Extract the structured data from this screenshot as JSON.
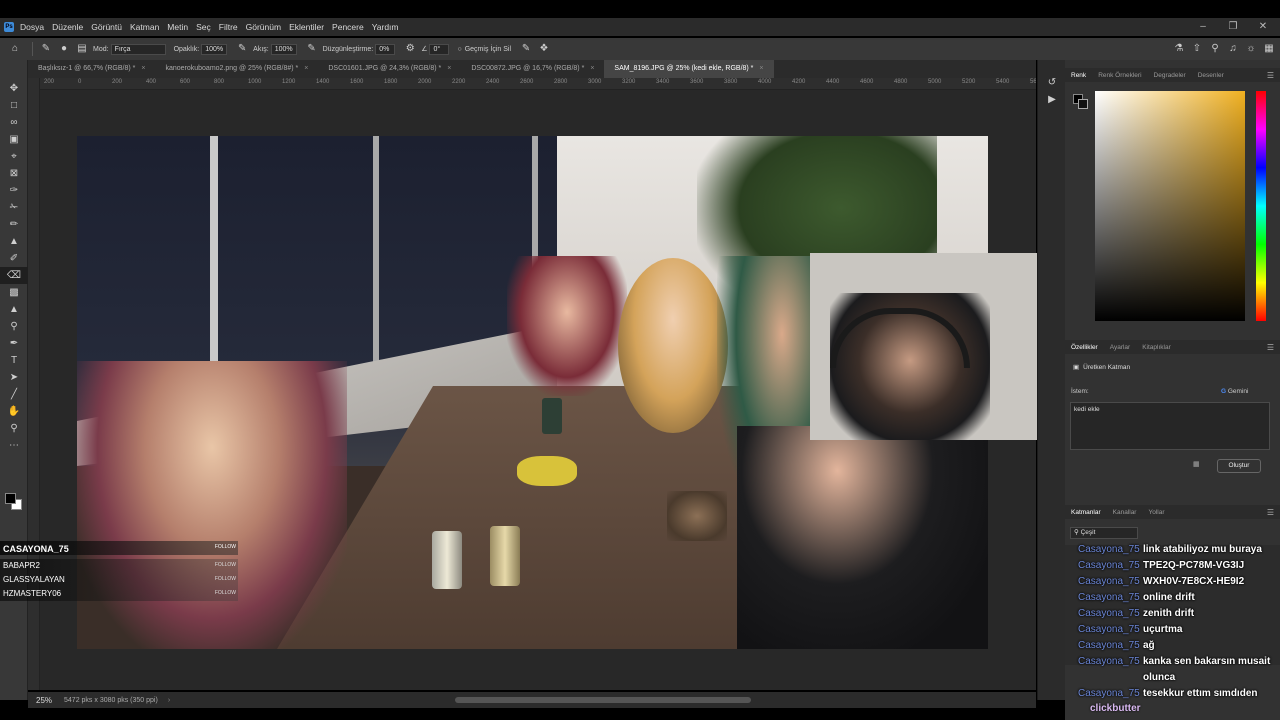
{
  "menu": {
    "items": [
      "Dosya",
      "Düzenle",
      "Görüntü",
      "Katman",
      "Metin",
      "Seç",
      "Filtre",
      "Görünüm",
      "Eklentiler",
      "Pencere",
      "Yardım"
    ]
  },
  "options": {
    "mode_label": "Mod:",
    "mode_value": "Fırça",
    "opacity_label": "Opaklık:",
    "opacity_value": "100%",
    "flow_label": "Akış:",
    "flow_value": "100%",
    "smoothing_label": "Düzgünleştirme:",
    "smoothing_value": "0%",
    "angle_value": "0°",
    "erase_history_label": "Geçmiş İçin Sil"
  },
  "tabs": [
    {
      "label": "Başlıksız-1 @ 66,7% (RGB/8) *",
      "active": false
    },
    {
      "label": "kanoerokuboamo2.png @ 25% (RGB/8#) *",
      "active": false
    },
    {
      "label": "DSC01601.JPG @ 24,3% (RGB/8) *",
      "active": false
    },
    {
      "label": "DSC00872.JPG @ 16,7% (RGB/8) *",
      "active": false
    },
    {
      "label": "SAM_8196.JPG @ 25% (kedi ekle, RGB/8) *",
      "active": true
    }
  ],
  "ruler": [
    "200",
    "0",
    "200",
    "400",
    "600",
    "800",
    "1000",
    "1200",
    "1400",
    "1600",
    "1800",
    "2000",
    "2200",
    "2400",
    "2600",
    "2800",
    "3000",
    "3200",
    "3400",
    "3600",
    "3800",
    "4000",
    "4200",
    "4400",
    "4600",
    "4800",
    "5000",
    "5200",
    "5400",
    "5600"
  ],
  "status": {
    "zoom": "25%",
    "doc_info": "5472 pks x 3080 pks (350 ppi)"
  },
  "color_panel": {
    "tabs": [
      "Renk",
      "Renk Örnekleri",
      "Degradeler",
      "Desenler"
    ]
  },
  "properties_panel": {
    "tabs": [
      "Özellikler",
      "Ayarlar",
      "Kitaplıklar"
    ],
    "layer_type": "Üretken Katman",
    "prompt_label": "İstem:",
    "model_label": "Gemini",
    "prompt_text": "kedi ekle",
    "generate_button": "Oluştur"
  },
  "layers_panel": {
    "tabs": [
      "Katmanlar",
      "Kanallar",
      "Yollar"
    ],
    "filter_label": "Çeşit"
  },
  "follow_panel": {
    "header_name": "CASAYONA_75",
    "header_tag": "FOLLOW",
    "rows": [
      {
        "name": "BABAPR2",
        "tag": "FOLLOW"
      },
      {
        "name": "GLASSYALAYAN",
        "tag": "FOLLOW"
      },
      {
        "name": "HZMASTERY06",
        "tag": "FOLLOW"
      }
    ]
  },
  "chat": [
    {
      "user": "Casayona_75",
      "msg": "link atabiliyoz mu buraya"
    },
    {
      "user": "Casayona_75",
      "msg": "TPE2Q-PC78M-VG3IJ"
    },
    {
      "user": "Casayona_75",
      "msg": "WXH0V-7E8CX-HE9I2"
    },
    {
      "user": "Casayona_75",
      "msg": "online drift"
    },
    {
      "user": "Casayona_75",
      "msg": "zenith drift"
    },
    {
      "user": "Casayona_75",
      "msg": "uçurtma"
    },
    {
      "user": "Casayona_75",
      "msg": "ağ"
    },
    {
      "user": "Casayona_75",
      "msg": "kanka sen bakarsın musait"
    },
    {
      "user": "",
      "msg": "olunca"
    },
    {
      "user": "Casayona_75",
      "msg": "tesekkur ettım sımdıden"
    }
  ],
  "chat_footer": "clickbutter",
  "colors": {
    "chat_user": "#6b86d6",
    "canvas_bg": "#282828",
    "panel_bg": "#323232"
  }
}
